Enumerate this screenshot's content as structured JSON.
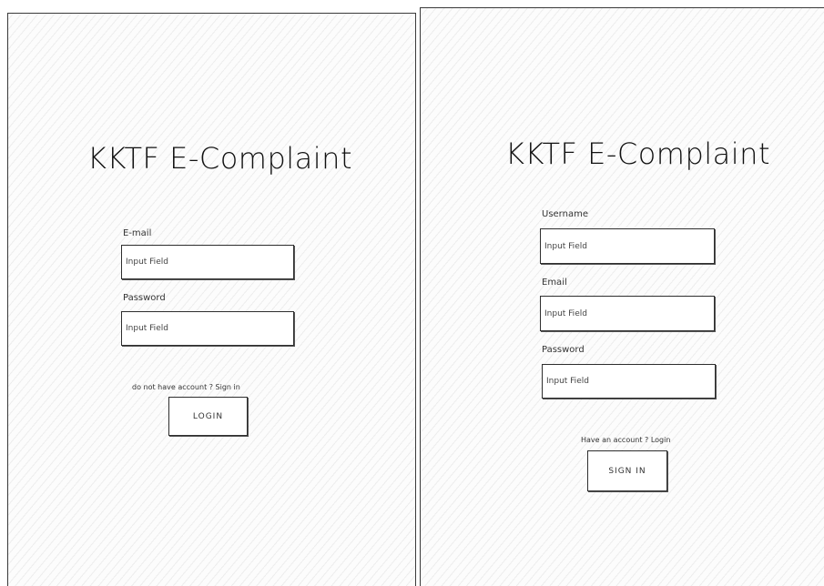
{
  "login": {
    "title": "KKTF E-Complaint",
    "email_label": "E-mail",
    "email_placeholder": "Input Field",
    "password_label": "Password",
    "password_placeholder": "Input Field",
    "signup_prompt": "do not have account ? Sign in",
    "login_button": "LOGIN"
  },
  "signup": {
    "title": "KKTF E-Complaint",
    "username_label": "Username",
    "username_placeholder": "Input Field",
    "email_label": "Email",
    "email_placeholder": "Input Field",
    "password_label": "Password",
    "password_placeholder": "Input Field",
    "login_prompt": "Have an account ? Login",
    "signin_button": "SIGN IN"
  }
}
